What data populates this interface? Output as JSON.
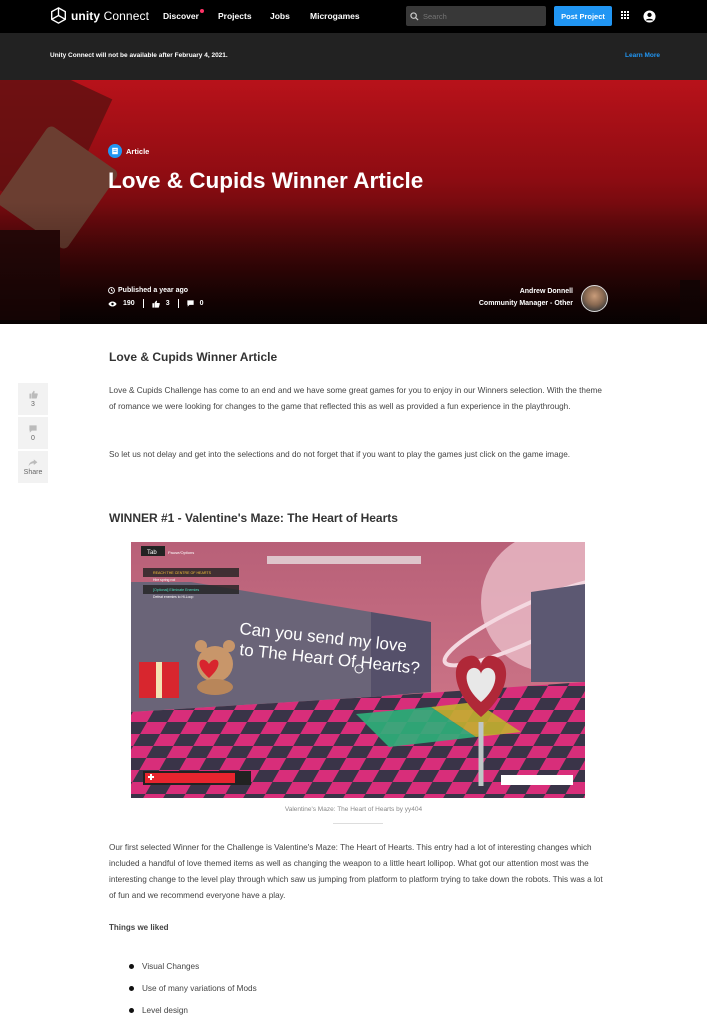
{
  "nav": {
    "logo_brand": "unity",
    "logo_product": "Connect",
    "items": [
      {
        "label": "Discover",
        "has_dot": true
      },
      {
        "label": "Projects"
      },
      {
        "label": "Jobs"
      },
      {
        "label": "Microgames"
      }
    ],
    "search_placeholder": "Search",
    "post_button": "Post Project",
    "icons": [
      "unity-logo-icon",
      "search-icon",
      "apps-grid-icon",
      "account-icon"
    ]
  },
  "announcement": {
    "text": "Unity Connect will not be available after February 4, 2021.",
    "link": "Learn More"
  },
  "hero": {
    "badge": "Article",
    "title": "Love & Cupids Winner Article",
    "published": "Published a year ago",
    "views": "190",
    "likes": "3",
    "comments": "0",
    "author_name": "Andrew Donnell",
    "author_role": "Community Manager - Other"
  },
  "side": {
    "likes": "3",
    "comments": "0",
    "share_label": "Share"
  },
  "article": {
    "heading": "Love & Cupids Winner Article",
    "intro": "Love & Cupids Challenge has come to an end and we have some great games for you to enjoy in our Winners selection. With the theme of romance we were looking for changes to the game that reflected this as well as provided a fun experience in the playthrough.",
    "intro2": "So let us not delay and get into the selections and do not forget that if you want to play the games just click on the game image.",
    "winner1_heading": "WINNER #1 - Valentine's Maze: The Heart of Hearts",
    "game": {
      "tab_key": "Tab",
      "tab_hint": "Pause/Options",
      "objective1": "REACH THE CENTRE OF HEARTS",
      "objective1_sub": "Hire spring rod",
      "objective2": "[Optional] Eliminate Enemies",
      "objective2_sub": "Defeat enemies to Hi-Loop",
      "sign_line1": "Can you send my love",
      "sign_line2": "to The Heart Of Hearts?",
      "colors": {
        "sky": "#c06a82",
        "floor_pink": "#e8347e",
        "floor_dark": "#3a3a4a",
        "wall": "#5a5a6a",
        "health": "#e8242e"
      }
    },
    "caption": "Valentine's Maze: The Heart of Hearts by yy404",
    "winner1_text": "Our first selected Winner for the Challenge is Valentine's Maze: The Heart of Hearts. This entry had a lot of interesting changes which included a handful of love themed items as well as changing the weapon to a little heart lollipop. What got our attention most was the interesting change to the level play through which saw us jumping from platform to platform trying to take down the robots. This was a lot of fun and we recommend everyone have a play.",
    "liked_heading": "Things we liked",
    "liked": [
      "Visual Changes",
      "Use of many variations of Mods",
      "Level design"
    ]
  }
}
